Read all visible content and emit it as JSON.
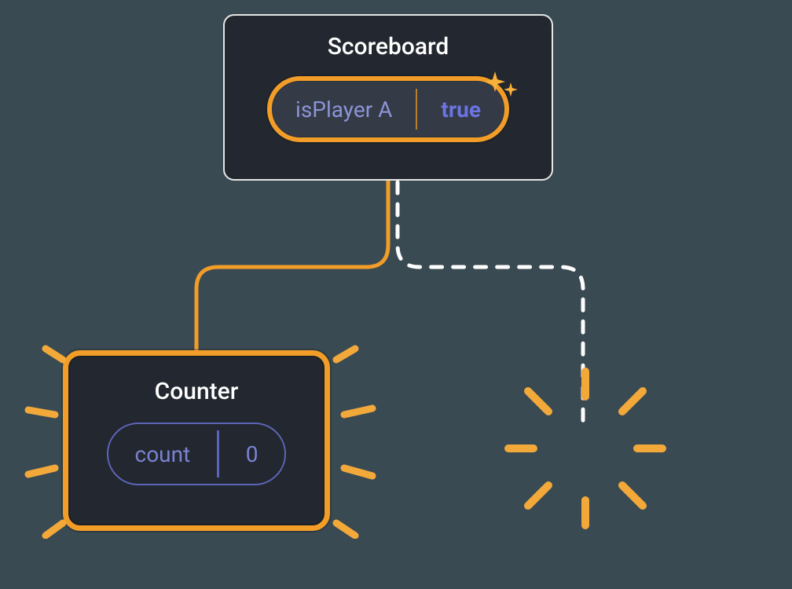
{
  "scoreboard": {
    "title": "Scoreboard",
    "state_key": "isPlayer A",
    "state_value": "true"
  },
  "counter": {
    "title": "Counter",
    "state_key": "count",
    "state_value": "0"
  },
  "colors": {
    "node_bg": "#23272f",
    "gold": "#f29d28",
    "purple": "#7a83d4",
    "purple_strong": "#6b74e0",
    "page_bg": "#3a4a53"
  }
}
